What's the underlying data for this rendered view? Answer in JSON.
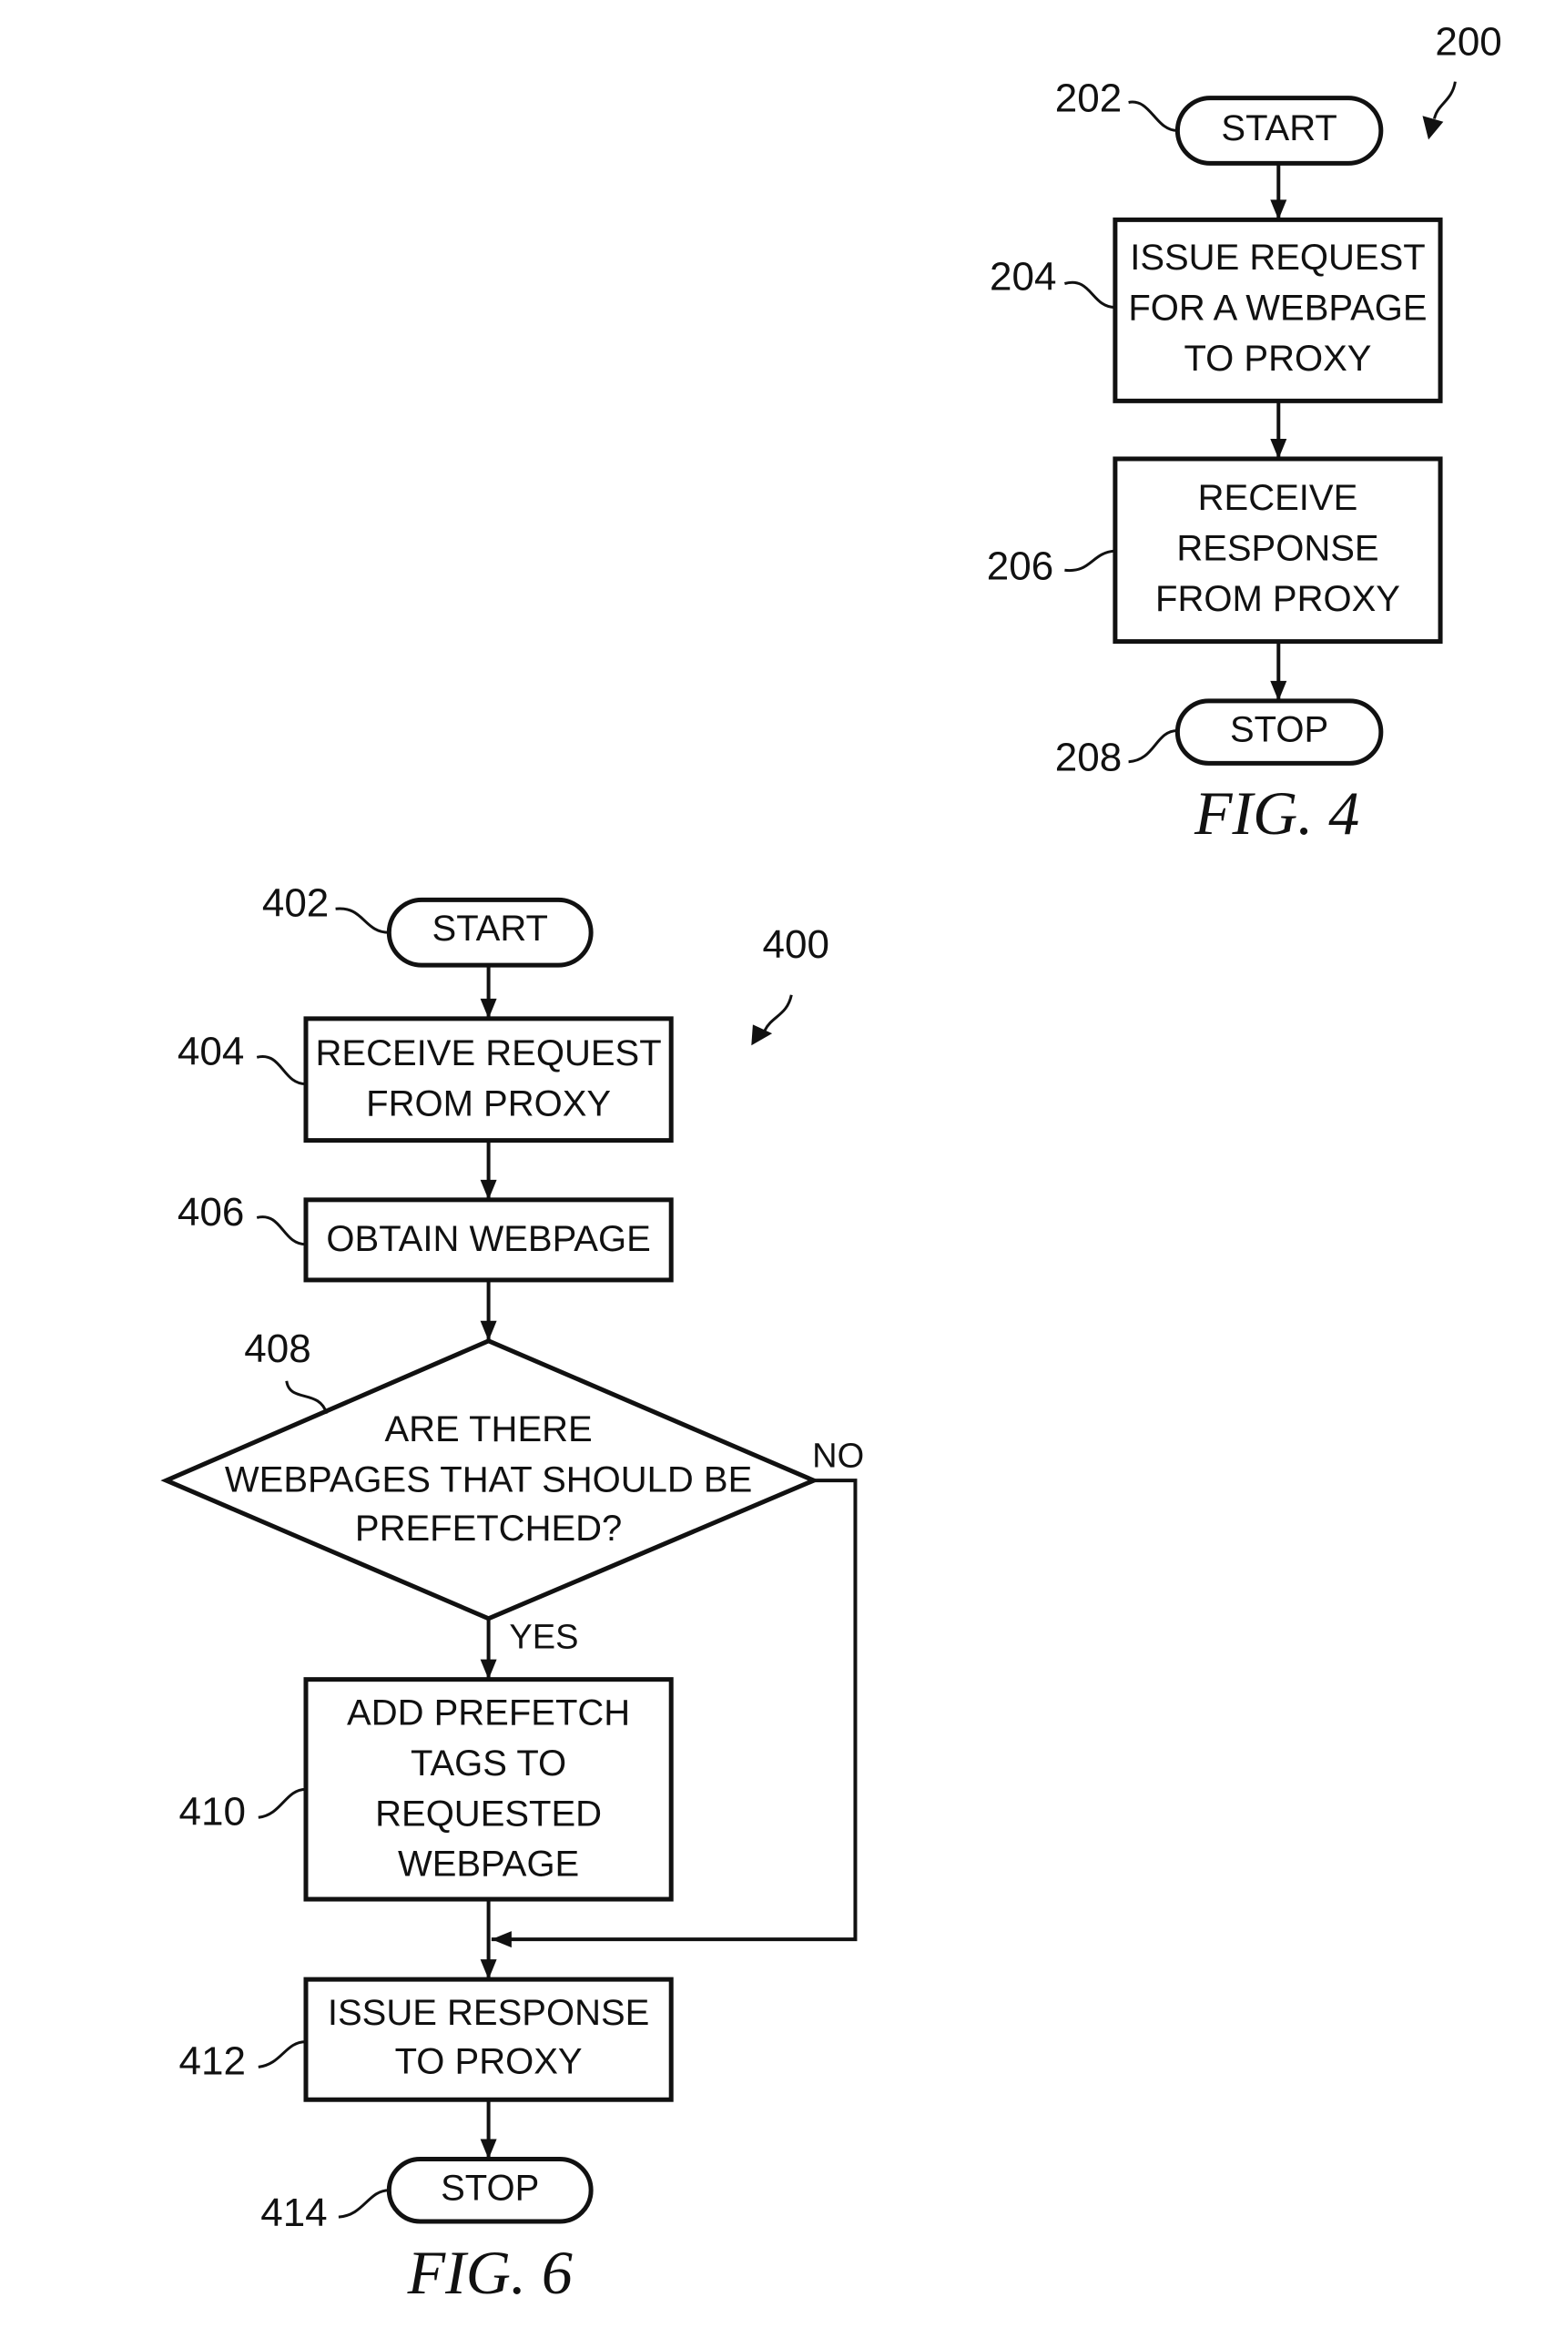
{
  "figures": [
    {
      "id": "fig4",
      "caption": "FIG. 4",
      "ref": "200",
      "nodes": [
        {
          "id": "202",
          "type": "terminal",
          "ref": "202",
          "lines": [
            "START"
          ]
        },
        {
          "id": "204",
          "type": "process",
          "ref": "204",
          "lines": [
            "ISSUE REQUEST",
            "FOR A WEBPAGE",
            "TO PROXY"
          ]
        },
        {
          "id": "206",
          "type": "process",
          "ref": "206",
          "lines": [
            "RECEIVE",
            "RESPONSE",
            "FROM PROXY"
          ]
        },
        {
          "id": "208",
          "type": "terminal",
          "ref": "208",
          "lines": [
            "STOP"
          ]
        }
      ],
      "edges": [
        {
          "from": "202",
          "to": "204",
          "label": ""
        },
        {
          "from": "204",
          "to": "206",
          "label": ""
        },
        {
          "from": "206",
          "to": "208",
          "label": ""
        }
      ]
    },
    {
      "id": "fig6",
      "caption": "FIG. 6",
      "ref": "400",
      "nodes": [
        {
          "id": "402",
          "type": "terminal",
          "ref": "402",
          "lines": [
            "START"
          ]
        },
        {
          "id": "404",
          "type": "process",
          "ref": "404",
          "lines": [
            "RECEIVE REQUEST",
            "FROM PROXY"
          ]
        },
        {
          "id": "406",
          "type": "process",
          "ref": "406",
          "lines": [
            "OBTAIN WEBPAGE"
          ]
        },
        {
          "id": "408",
          "type": "decision",
          "ref": "408",
          "lines": [
            "ARE THERE",
            "WEBPAGES THAT SHOULD BE",
            "PREFETCHED?"
          ]
        },
        {
          "id": "410",
          "type": "process",
          "ref": "410",
          "lines": [
            "ADD PREFETCH",
            "TAGS TO",
            "REQUESTED",
            "WEBPAGE"
          ]
        },
        {
          "id": "412",
          "type": "process",
          "ref": "412",
          "lines": [
            "ISSUE RESPONSE",
            "TO PROXY"
          ]
        },
        {
          "id": "414",
          "type": "terminal",
          "ref": "414",
          "lines": [
            "STOP"
          ]
        }
      ],
      "edges": [
        {
          "from": "402",
          "to": "404",
          "label": ""
        },
        {
          "from": "404",
          "to": "406",
          "label": ""
        },
        {
          "from": "406",
          "to": "408",
          "label": ""
        },
        {
          "from": "408",
          "to": "410",
          "label": "YES"
        },
        {
          "from": "408",
          "to": "412",
          "label": "NO"
        },
        {
          "from": "410",
          "to": "412",
          "label": ""
        },
        {
          "from": "412",
          "to": "414",
          "label": ""
        }
      ]
    }
  ]
}
